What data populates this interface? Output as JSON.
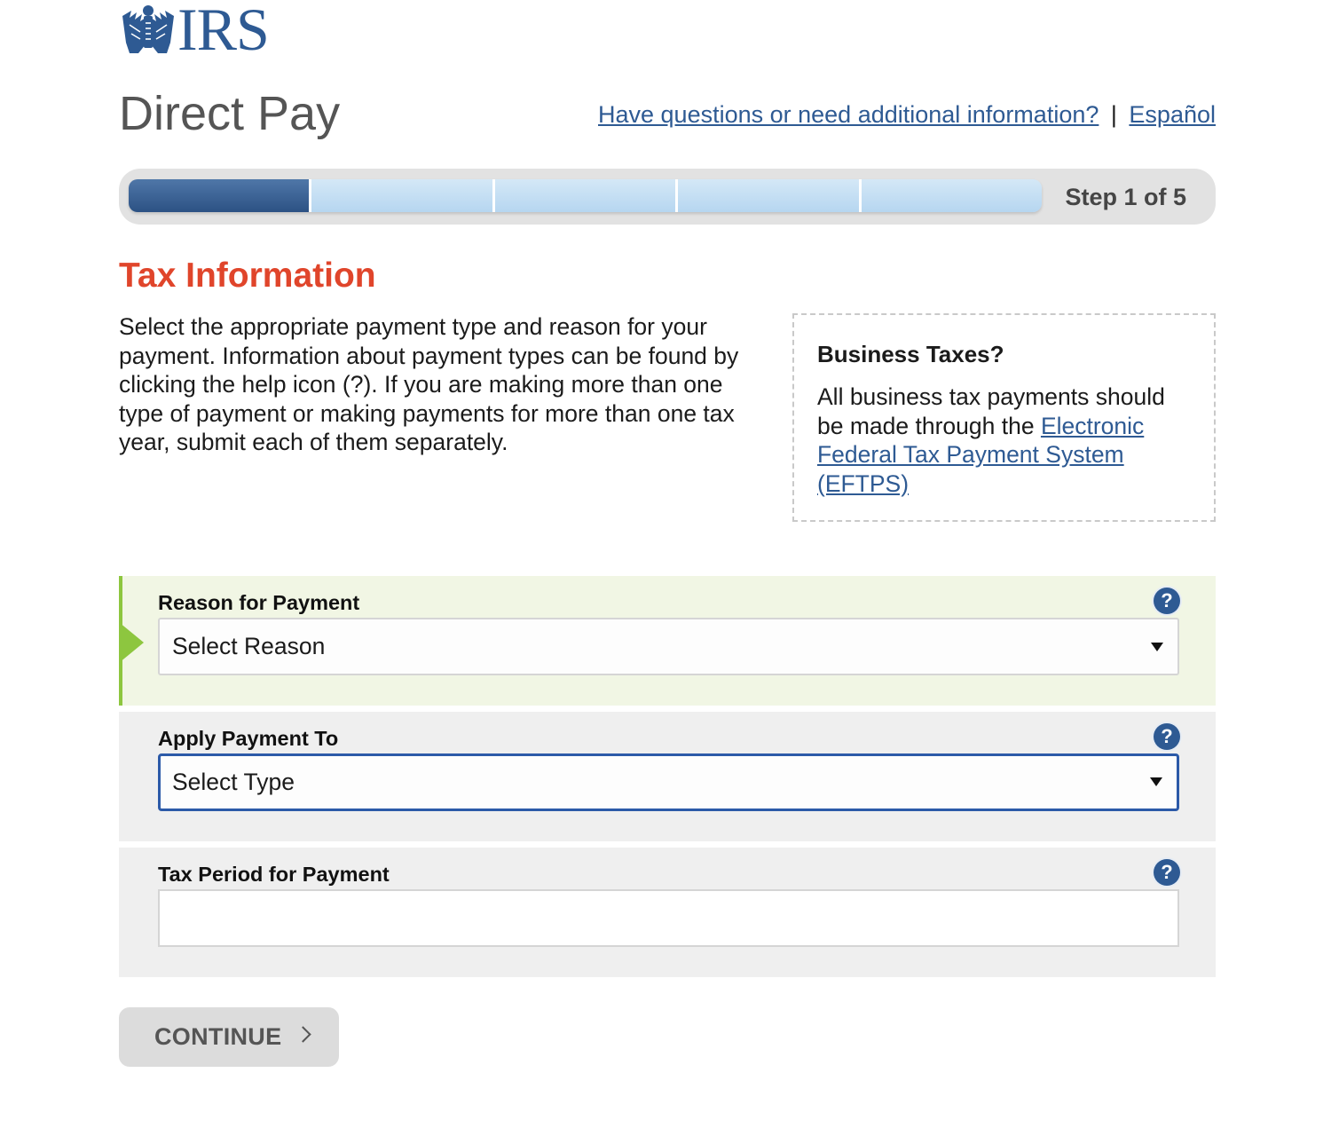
{
  "logo": {
    "wordmark": "IRS"
  },
  "header": {
    "title": "Direct Pay",
    "help_link": "Have questions or need additional information?",
    "separator": "|",
    "language_link": "Español"
  },
  "progress": {
    "current_step": 1,
    "total_steps": 5,
    "label": "Step 1 of 5"
  },
  "section": {
    "title": "Tax Information",
    "intro": "Select the appropriate payment type and reason for your payment. Information about payment types can be found by clicking the help icon (?). If you are making more than one type of payment or making payments for more than one tax year, submit each of them separately."
  },
  "business_box": {
    "heading": "Business Taxes?",
    "text": "All business tax payments should be made through the ",
    "link": "Electronic Federal Tax Payment System (EFTPS)"
  },
  "form": {
    "reason": {
      "label": "Reason for Payment",
      "value": "Select Reason",
      "help": "?"
    },
    "apply_to": {
      "label": "Apply Payment To",
      "value": "Select Type",
      "help": "?"
    },
    "tax_period": {
      "label": "Tax Period for Payment",
      "value": "",
      "help": "?"
    }
  },
  "actions": {
    "continue_label": "CONTINUE"
  },
  "colors": {
    "brand_blue": "#2e5a93",
    "heading_red": "#e0452b",
    "active_green": "#8dc63f"
  }
}
